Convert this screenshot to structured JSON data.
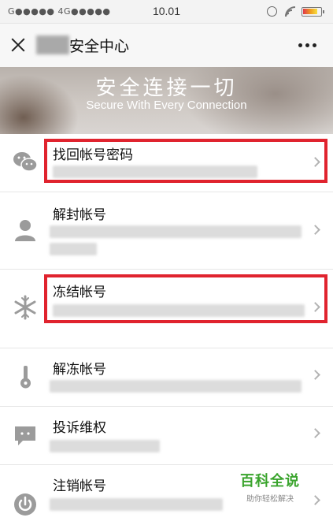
{
  "status_bar": {
    "carrier": "G●●●●● 4G●●●●●",
    "time": "10.01"
  },
  "nav": {
    "title": "安全中心",
    "close_icon": "close-icon",
    "more_icon": "more-icon"
  },
  "banner": {
    "title": "安全连接一切",
    "subtitle": "Secure With Every Connection"
  },
  "list": [
    {
      "label": "找回帐号密码",
      "icon": "wechat-chat-icon",
      "highlighted": true
    },
    {
      "label": "解封帐号",
      "icon": "user-icon",
      "highlighted": false
    },
    {
      "label": "冻结帐号",
      "icon": "snowflake-icon",
      "highlighted": true
    },
    {
      "label": "解冻帐号",
      "icon": "key-icon",
      "highlighted": false
    },
    {
      "label": "投诉维权",
      "icon": "message-icon",
      "highlighted": false
    },
    {
      "label": "注销帐号",
      "icon": "power-icon",
      "highlighted": false
    }
  ],
  "watermark": {
    "logo": "百科全说",
    "slogan": "助你轻松解决"
  },
  "colors": {
    "highlight": "#e0232e",
    "watermark": "#3aa42d",
    "icon_gray": "#9b9b9b"
  }
}
